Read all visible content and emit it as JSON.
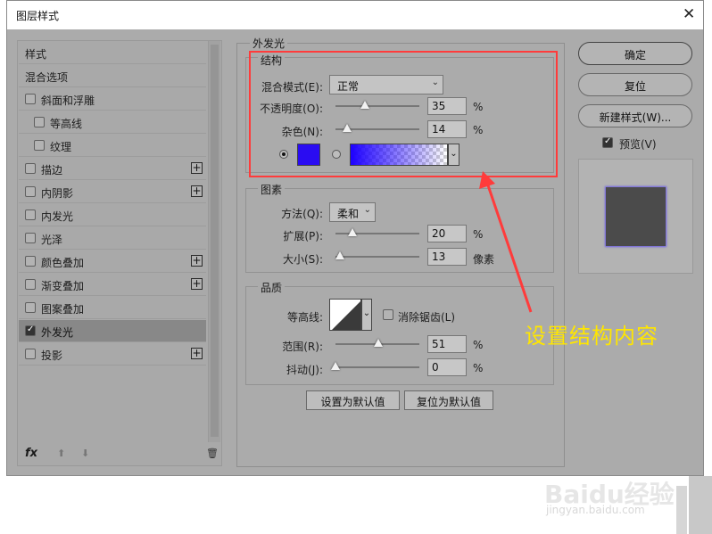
{
  "dialog": {
    "title": "图层样式",
    "close": "✕"
  },
  "style_list": {
    "items": [
      {
        "label": "样式",
        "checkbox": false,
        "checked": false,
        "plus": false,
        "indent": 0,
        "selected": false
      },
      {
        "label": "混合选项",
        "checkbox": false,
        "checked": false,
        "plus": false,
        "indent": 0,
        "selected": false
      },
      {
        "label": "斜面和浮雕",
        "checkbox": true,
        "checked": false,
        "plus": false,
        "indent": 0,
        "selected": false
      },
      {
        "label": "等高线",
        "checkbox": true,
        "checked": false,
        "plus": false,
        "indent": 1,
        "selected": false
      },
      {
        "label": "纹理",
        "checkbox": true,
        "checked": false,
        "plus": false,
        "indent": 1,
        "selected": false
      },
      {
        "label": "描边",
        "checkbox": true,
        "checked": false,
        "plus": true,
        "indent": 0,
        "selected": false
      },
      {
        "label": "内阴影",
        "checkbox": true,
        "checked": false,
        "plus": true,
        "indent": 0,
        "selected": false
      },
      {
        "label": "内发光",
        "checkbox": true,
        "checked": false,
        "plus": false,
        "indent": 0,
        "selected": false
      },
      {
        "label": "光泽",
        "checkbox": true,
        "checked": false,
        "plus": false,
        "indent": 0,
        "selected": false
      },
      {
        "label": "颜色叠加",
        "checkbox": true,
        "checked": false,
        "plus": true,
        "indent": 0,
        "selected": false
      },
      {
        "label": "渐变叠加",
        "checkbox": true,
        "checked": false,
        "plus": true,
        "indent": 0,
        "selected": false
      },
      {
        "label": "图案叠加",
        "checkbox": true,
        "checked": false,
        "plus": false,
        "indent": 0,
        "selected": false
      },
      {
        "label": "外发光",
        "checkbox": true,
        "checked": true,
        "plus": false,
        "indent": 0,
        "selected": true
      },
      {
        "label": "投影",
        "checkbox": true,
        "checked": false,
        "plus": true,
        "indent": 0,
        "selected": false
      }
    ],
    "footer": {
      "fx": "fx",
      "up": "⬆",
      "down": "⬇",
      "trash": "🗑"
    }
  },
  "outer_glow": {
    "section_title": "外发光",
    "structure": {
      "title": "结构",
      "blend_mode_label": "混合模式(E):",
      "blend_mode_value": "正常",
      "opacity_label": "不透明度(O):",
      "opacity_value": "35",
      "opacity_level": 0.35,
      "noise_label": "杂色(N):",
      "noise_value": "14",
      "noise_level": 0.14,
      "percent": "%",
      "glow_color": "#2a0cf2",
      "gradient_start": "#1d00ff"
    },
    "elements": {
      "title": "图素",
      "method_label": "方法(Q):",
      "method_value": "柔和",
      "spread_label": "扩展(P):",
      "spread_value": "20",
      "spread_level": 0.2,
      "size_label": "大小(S):",
      "size_value": "13",
      "size_level": 0.05,
      "percent": "%",
      "pixels": "像素"
    },
    "quality": {
      "title": "品质",
      "contour_label": "等高线:",
      "antialias_label": "消除锯齿(L)",
      "range_label": "范围(R):",
      "range_value": "51",
      "range_level": 0.51,
      "jitter_label": "抖动(J):",
      "jitter_value": "0",
      "jitter_level": 0.0,
      "percent": "%"
    },
    "buttons": {
      "set_default": "设置为默认值",
      "reset_default": "复位为默认值"
    }
  },
  "right_buttons": {
    "ok": "确定",
    "reset": "复位",
    "new_style": "新建样式(W)...",
    "preview_label": "预览(V)",
    "preview_checked": true
  },
  "annotation": {
    "text": "设置结构内容",
    "color": "#ffe600",
    "box_color": "#ff3b3b"
  },
  "watermark": {
    "brand": "Baidu经验",
    "url": "jingyan.baidu.com"
  }
}
